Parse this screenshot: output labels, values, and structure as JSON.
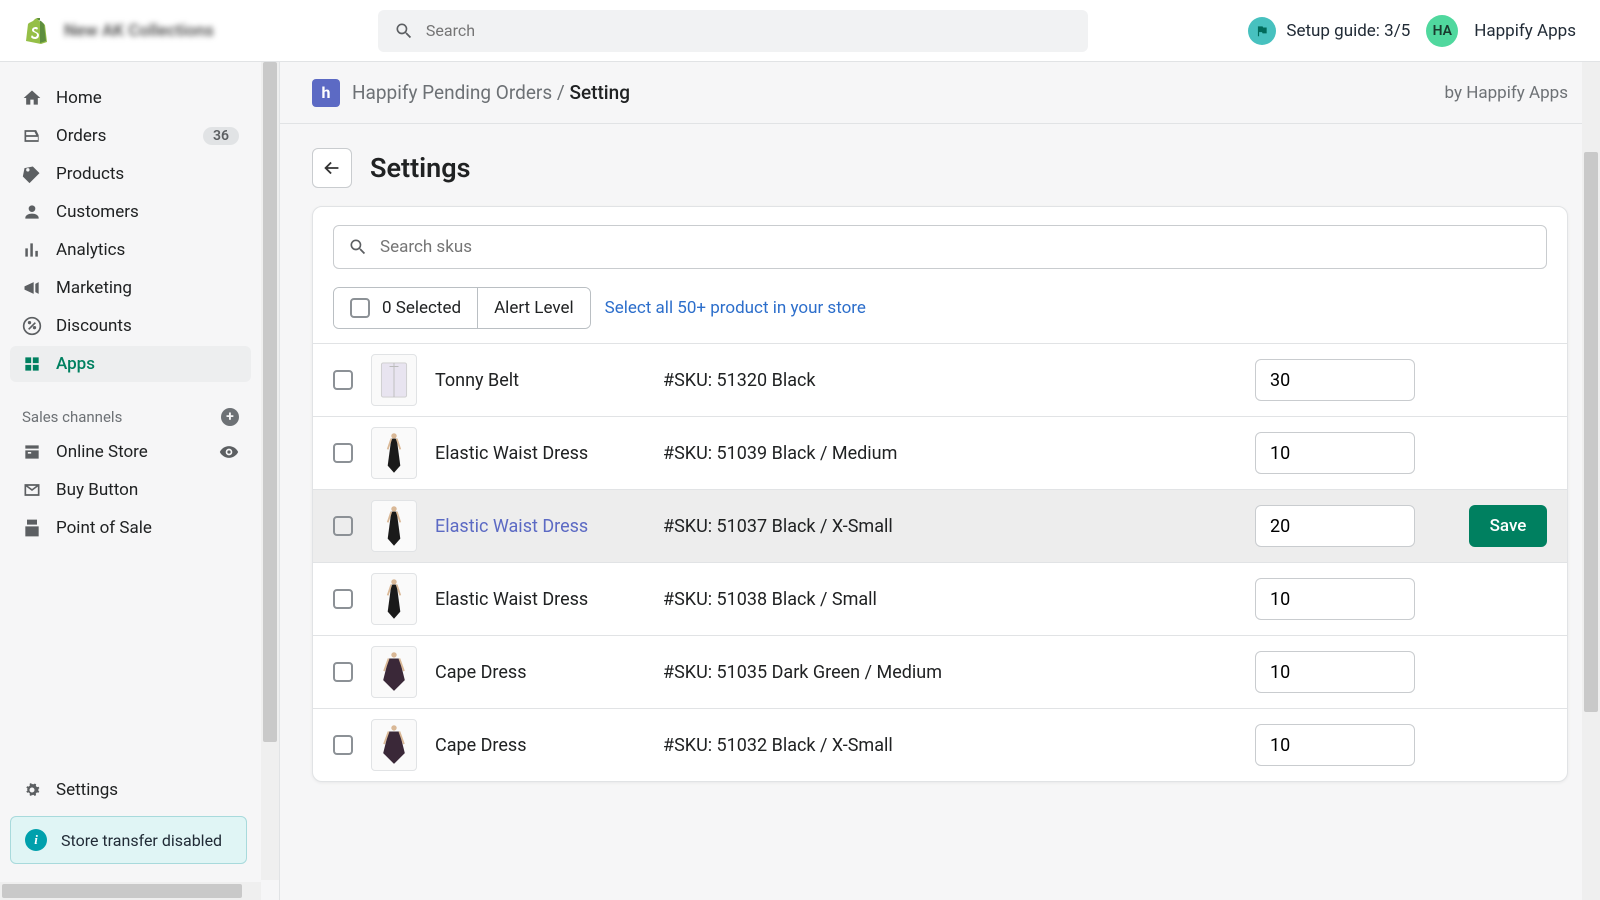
{
  "top": {
    "store_name": "New AK Collections",
    "search_placeholder": "Search",
    "setup_guide": "Setup guide: 3/5",
    "avatar_initials": "HA",
    "user_name": "Happify Apps"
  },
  "sidebar": {
    "items": [
      {
        "label": "Home"
      },
      {
        "label": "Orders",
        "badge": "36"
      },
      {
        "label": "Products"
      },
      {
        "label": "Customers"
      },
      {
        "label": "Analytics"
      },
      {
        "label": "Marketing"
      },
      {
        "label": "Discounts"
      },
      {
        "label": "Apps",
        "active": true
      }
    ],
    "section_title": "Sales channels",
    "channels": [
      {
        "label": "Online Store",
        "has_eye": true
      },
      {
        "label": "Buy Button"
      },
      {
        "label": "Point of Sale"
      }
    ],
    "settings_label": "Settings",
    "transfer_notice": "Store transfer disabled"
  },
  "breadcrumb": {
    "app_name": "Happify Pending Orders",
    "separator": "/",
    "current": "Setting",
    "by": "by Happify Apps"
  },
  "page": {
    "title": "Settings",
    "sku_search_placeholder": "Search skus",
    "selected_label": "0 Selected",
    "alert_level_label": "Alert Level",
    "select_all_label": "Select all 50+ product in your store",
    "save_label": "Save"
  },
  "products": [
    {
      "name": "Tonny Belt",
      "sku": "#SKU: 51320 Black",
      "qty": "30",
      "thumb": "shirt"
    },
    {
      "name": "Elastic Waist Dress",
      "sku": "#SKU: 51039 Black / Medium",
      "qty": "10",
      "thumb": "dress-black"
    },
    {
      "name": "Elastic Waist Dress",
      "sku": "#SKU: 51037 Black / X-Small",
      "qty": "20",
      "thumb": "dress-black",
      "selected": true
    },
    {
      "name": "Elastic Waist Dress",
      "sku": "#SKU: 51038 Black / Small",
      "qty": "10",
      "thumb": "dress-black"
    },
    {
      "name": "Cape Dress",
      "sku": "#SKU: 51035 Dark Green / Medium",
      "qty": "10",
      "thumb": "cape"
    },
    {
      "name": "Cape Dress",
      "sku": "#SKU: 51032 Black / X-Small",
      "qty": "10",
      "thumb": "cape"
    }
  ]
}
